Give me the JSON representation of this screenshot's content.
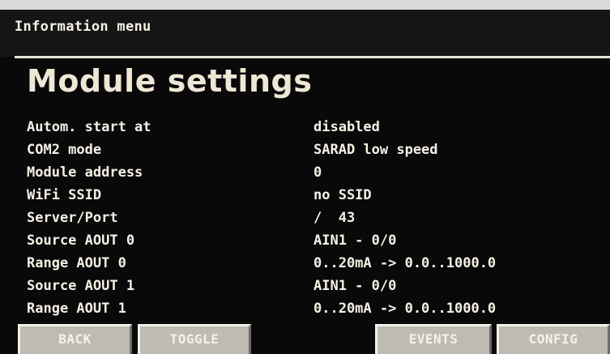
{
  "header": {
    "title": "Information menu"
  },
  "page": {
    "title": "Module settings"
  },
  "settings": [
    {
      "label": "Autom. start at",
      "value": "disabled"
    },
    {
      "label": "COM2 mode",
      "value": "SARAD low speed"
    },
    {
      "label": "Module address",
      "value": "0"
    },
    {
      "label": "WiFi SSID",
      "value": "no SSID"
    },
    {
      "label": "Server/Port",
      "value": "/  43"
    },
    {
      "label": "Source AOUT 0",
      "value": "AIN1 - 0/0"
    },
    {
      "label": "Range AOUT 0",
      "value": "0..20mA -> 0.0..1000.0"
    },
    {
      "label": "Source AOUT 1",
      "value": "AIN1 - 0/0"
    },
    {
      "label": "Range AOUT 1",
      "value": "0..20mA -> 0.0..1000.0"
    }
  ],
  "buttons": {
    "back": "BACK",
    "toggle": "TOGGLE",
    "events": "EVENTS",
    "config": "CONFIG"
  }
}
